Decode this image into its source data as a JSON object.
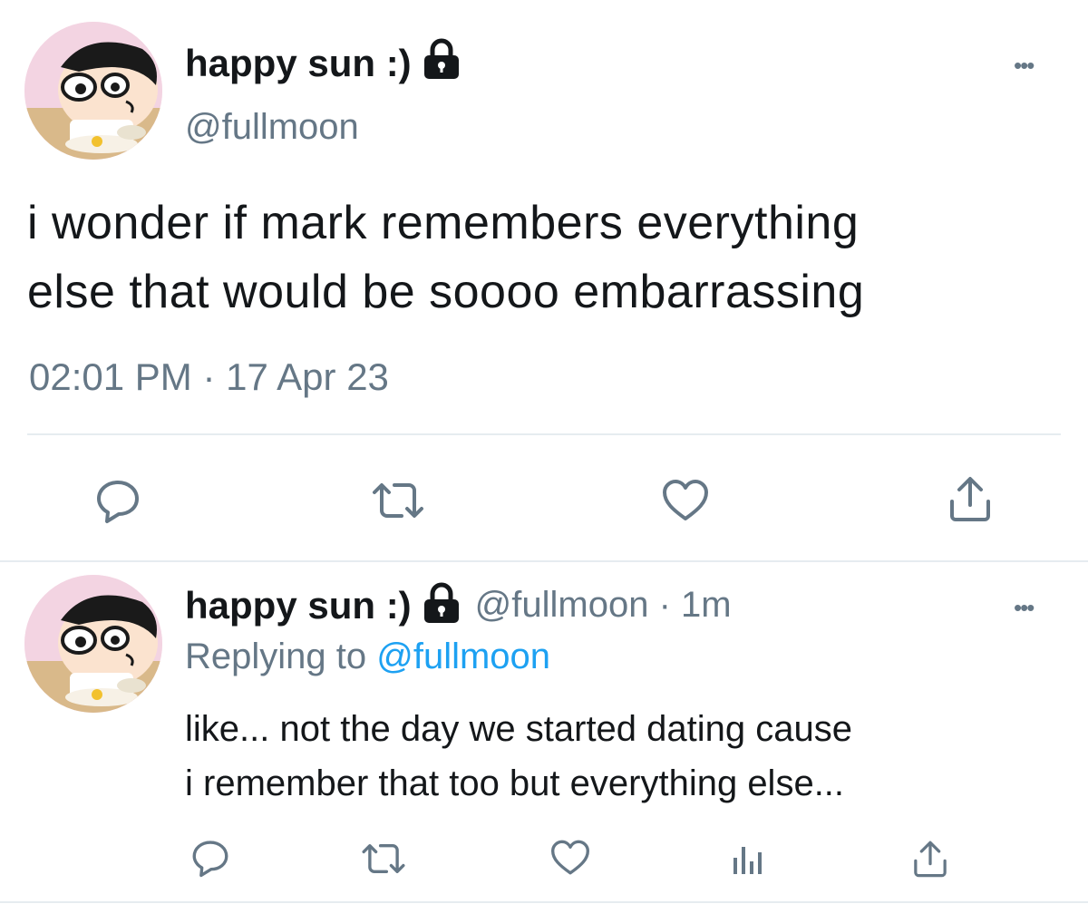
{
  "main_tweet": {
    "author_name": "happy sun :)",
    "handle": "@fullmoon",
    "text_line1": "i wonder if mark remembers everything",
    "text_line2": "else that would be soooo embarrassing",
    "timestamp": "02:01 PM · 17 Apr 23",
    "more_label": "•••",
    "avatar_icon": "cartoon-boy-avatar",
    "lock_icon": "lock-icon",
    "actions": [
      "reply-icon",
      "retweet-icon",
      "like-icon",
      "share-icon"
    ]
  },
  "reply_tweet": {
    "author_name": "happy sun :)",
    "handle_time": "@fullmoon · 1m",
    "replying_prefix": "Replying to",
    "replying_mention": "@fullmoon",
    "text_line1": "like... not the day we started dating cause",
    "text_line2": "i remember that too but everything else...",
    "more_label": "•••",
    "actions": [
      "reply-icon",
      "retweet-icon",
      "like-icon",
      "analytics-icon",
      "share-icon"
    ]
  },
  "colors": {
    "text": "#14171a",
    "secondary": "#657786",
    "accent": "#1da1f2",
    "divider": "#e6ecf0"
  }
}
